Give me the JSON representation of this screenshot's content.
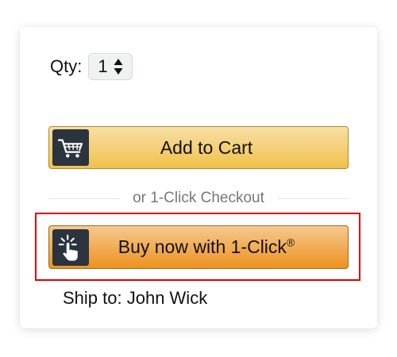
{
  "quantity": {
    "label": "Qty:",
    "value": "1",
    "arrows_icon": "up-down-arrows-icon"
  },
  "add_to_cart": {
    "label": "Add to Cart",
    "icon": "shopping-cart-icon"
  },
  "divider": {
    "text": "or 1-Click Checkout"
  },
  "buy_now": {
    "label": "Buy now with 1-Click",
    "registered_mark": "®",
    "icon": "tap-hand-icon"
  },
  "shipping": {
    "text": "Ship to: John Wick"
  },
  "colors": {
    "add_to_cart_button": "#f0c14b",
    "buy_now_button": "#ed9220",
    "icon_background": "#2b333e",
    "highlight_outline": "#e30000",
    "divider_text": "#767676"
  }
}
